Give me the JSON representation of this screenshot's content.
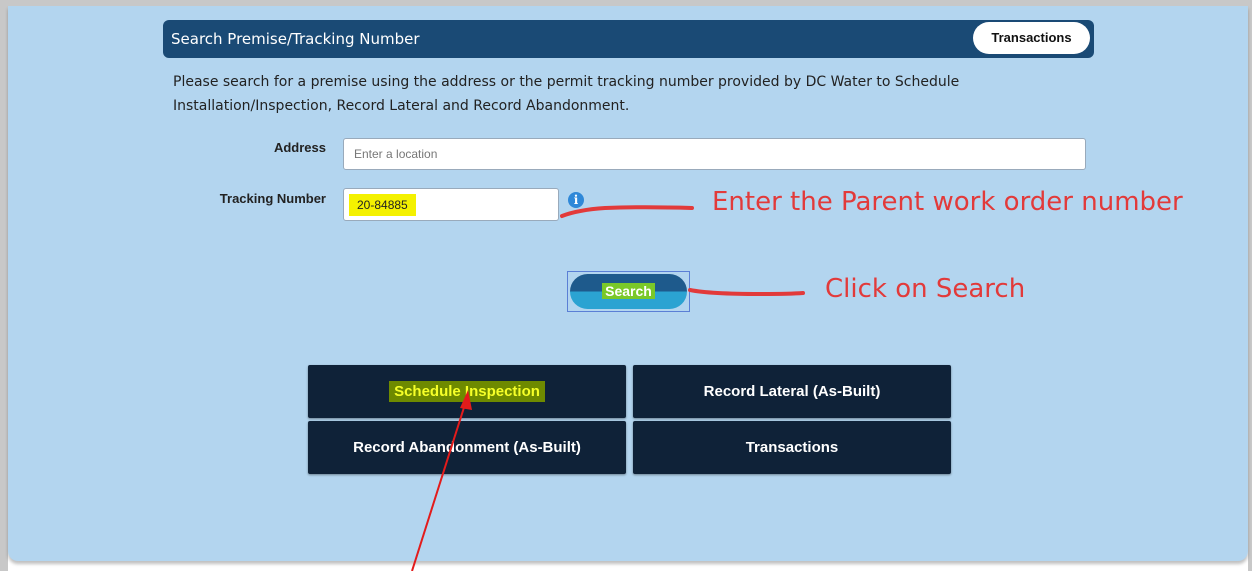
{
  "header": {
    "title": "Search Premise/Tracking Number",
    "transactions_label": "Transactions"
  },
  "description": "Please search for a premise using the address or the permit tracking number provided by DC Water to Schedule Installation/Inspection, Record Lateral and Record Abandonment.",
  "form": {
    "address_label": "Address",
    "address_placeholder": "Enter a location",
    "tracking_label": "Tracking Number",
    "tracking_value": "20-84885",
    "info_glyph": "i"
  },
  "search_label": "Search",
  "annotations": {
    "tracking_note": "Enter the Parent work order number",
    "search_note": "Click on Search"
  },
  "actions": {
    "schedule_inspection": "Schedule Inspection",
    "record_lateral": "Record Lateral (As-Built)",
    "record_abandonment": "Record Abandonment (As-Built)",
    "transactions": "Transactions"
  },
  "colors": {
    "panel_bg": "#b3d5ef",
    "header_bg": "#1a4a75",
    "action_bg": "#0f2238",
    "annotation": "#e23a3a",
    "highlight": "#f4f100"
  }
}
